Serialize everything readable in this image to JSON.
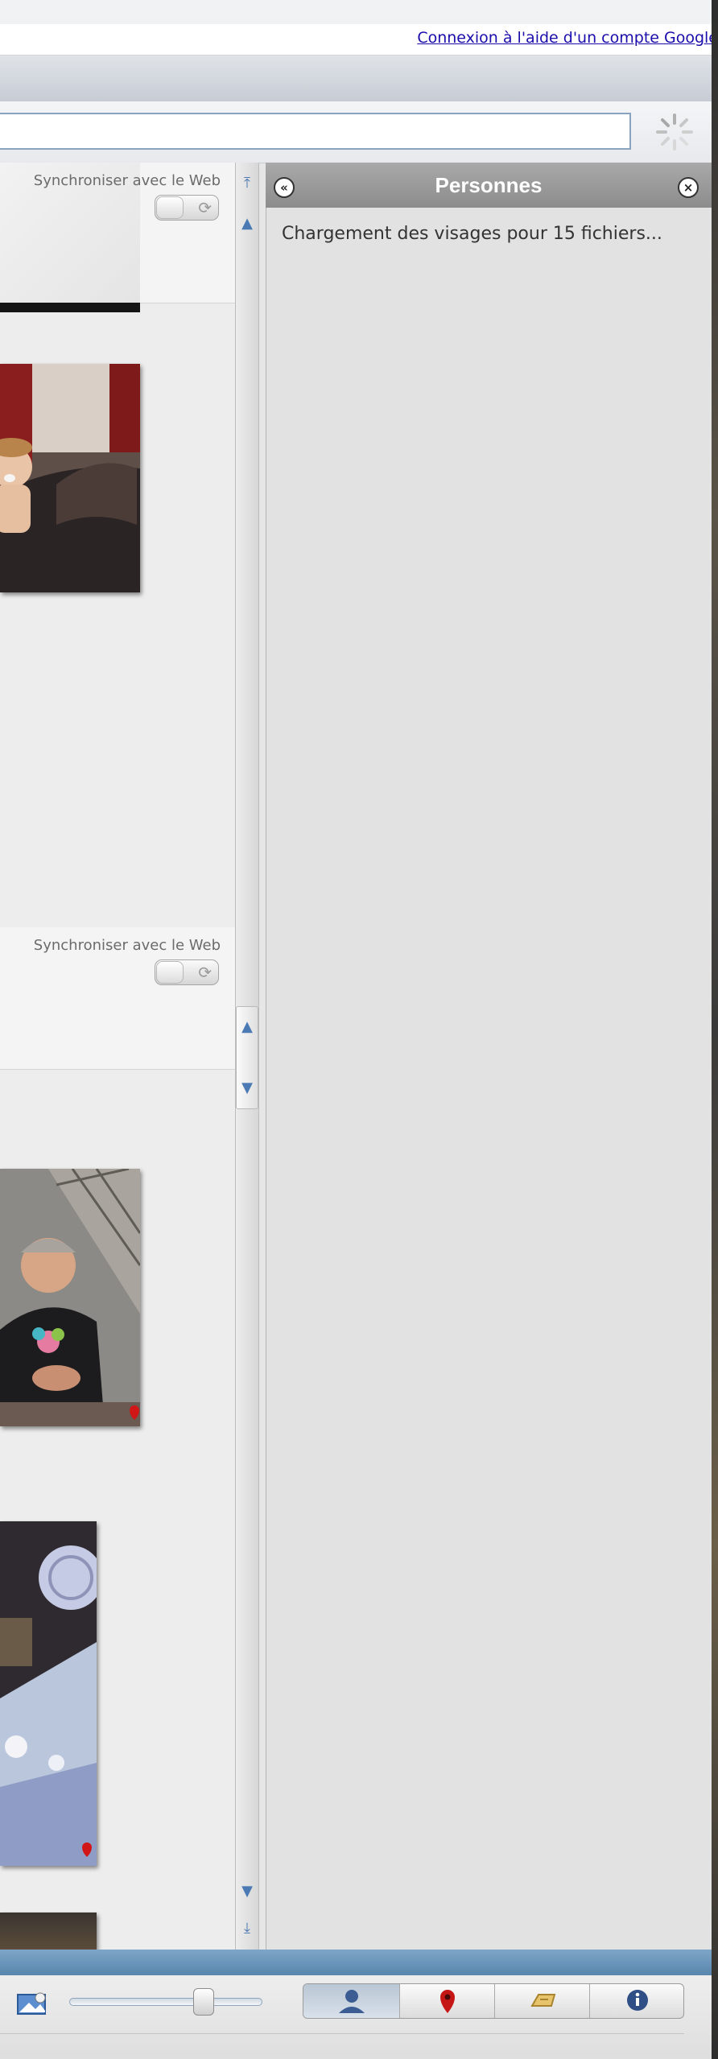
{
  "account_link": "Connexion à l'aide d'un compte Google",
  "library": {
    "sections": [
      {
        "sync_label": "Synchroniser avec le Web"
      },
      {
        "sync_label": "Synchroniser avec le Web"
      }
    ]
  },
  "people_panel": {
    "title": "Personnes",
    "status": "Chargement des visages pour 15 fichiers..."
  },
  "bottom_toolbar": {
    "zoom_level": 0.72,
    "tabs": [
      "people-tab",
      "places-tab",
      "tags-tab",
      "info-tab"
    ],
    "active_tab": "people-tab"
  },
  "icons": {
    "collapse": "chevrons-left-icon",
    "close": "close-icon",
    "spinner": "loading-spinner-icon",
    "map_pin": "map-pin-icon"
  },
  "colors": {
    "link": "#1a0dab",
    "panel_header": "#9a9a9a",
    "accent_blue": "#5886ad",
    "pin_red": "#d01616"
  }
}
